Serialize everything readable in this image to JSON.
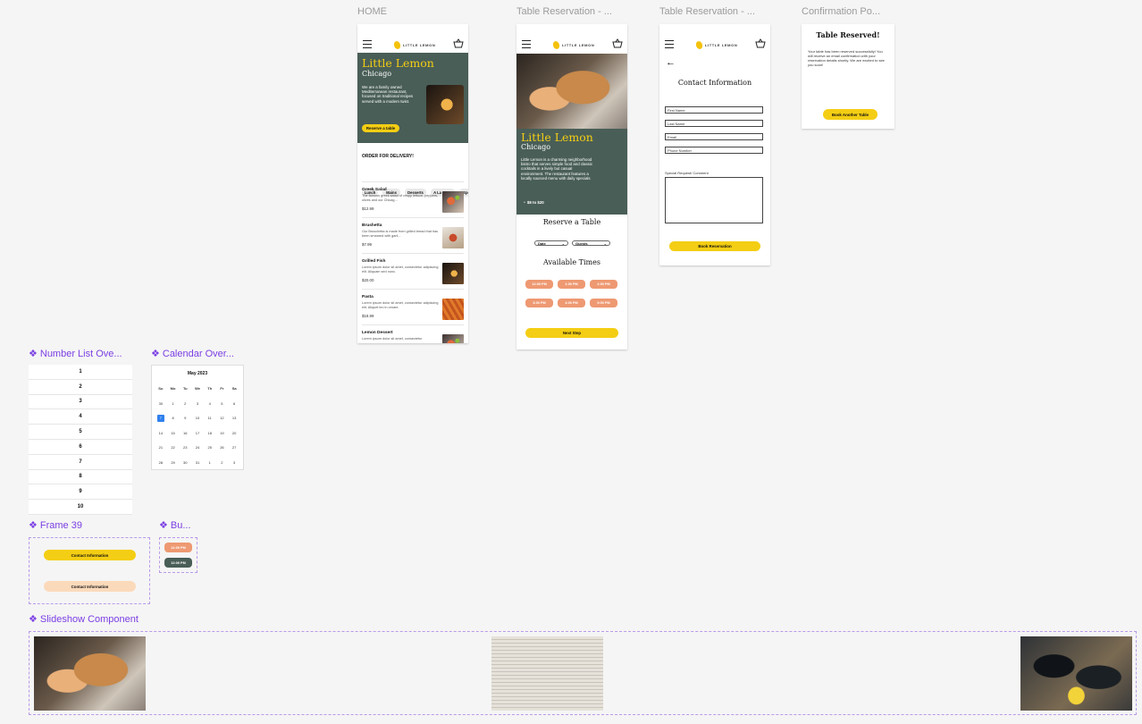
{
  "frames": {
    "home": "HOME",
    "reservation1": "Table Reservation - ...",
    "reservation2": "Table Reservation - ...",
    "confirmation": "Confirmation Po..."
  },
  "brand": {
    "logo_text": "LITTLE LEMON",
    "yellow": "#f4ce14",
    "green": "#495e57",
    "orange": "#ee9972",
    "peach": "#fbdabb",
    "purple": "#7b3fe4"
  },
  "home": {
    "title": "Little Lemon",
    "city": "Chicago",
    "description": "We are a family owned Mediterranean restaurant, focused on traditional recipes served with a modern twist.",
    "cta": "Reserve a table",
    "delivery_heading": "ORDER FOR DELIVERY!",
    "categories": [
      "Lunch",
      "Mains",
      "Desserts",
      "A La Carte",
      "Spe"
    ],
    "menu": [
      {
        "name": "Greek Salad",
        "desc": "The famous greek salad of crispy lettuce, peppers, olives and our Chicag...",
        "price": "$12.99"
      },
      {
        "name": "Brushetta",
        "desc": "Our Bruschetta is made from grilled bread that has been smeared with garli...",
        "price": "$7.99"
      },
      {
        "name": "Grilled Fish",
        "desc": "Lorem ipsum dolor sit amet, consectetur adipiscing elit. Aliquam sed nunc.",
        "price": "$20.00"
      },
      {
        "name": "Pasta",
        "desc": "Lorem ipsum dolor sit amet, consectetur adipiscing elit. Aliquet leo in ornare.",
        "price": "$18.99"
      },
      {
        "name": "Lemon Dessert",
        "desc": "Lorem ipsum dolor sit amet, consectetur",
        "price": ""
      }
    ]
  },
  "reservation": {
    "title": "Little Lemon",
    "city": "Chicago",
    "description": "Little Lemon is a charming neighborhood bistro that serves simple food and classic cocktails in a lively but casual environment. The restaurant features a locally sourced menu with daily specials",
    "price_range": "$8 to $20",
    "reserve_heading": "Reserve a Table",
    "date_label": "Date",
    "guests_label": "Guests",
    "times_heading": "Available Times",
    "times": [
      "12:00 PM",
      "1:00 PM",
      "2:00 PM",
      "3:00 PM",
      "4:00 PM",
      "5:00 PM"
    ],
    "next": "Next Step"
  },
  "contact": {
    "heading": "Contact Information",
    "fields": [
      "First Name",
      "Last Name",
      "Email",
      "Phone Number"
    ],
    "special_label": "Special Request/ Comment",
    "submit": "Book Reservation"
  },
  "confirmation": {
    "heading": "Table Reserved!",
    "body": "Your table has been reserved successfully! You will receive an email confirmation with your reservation details shortly. We are excited to see you soon!",
    "button": "Book Another Table"
  },
  "components": {
    "number_list": "Number List Ove...",
    "calendar": "Calendar Over...",
    "frame39": "Frame 39",
    "button": "Bu...",
    "slideshow": "Slideshow Component"
  },
  "number_list": [
    "1",
    "2",
    "3",
    "4",
    "5",
    "6",
    "7",
    "8",
    "9",
    "10"
  ],
  "calendar": {
    "month": "May 2023",
    "weekdays": [
      "Su",
      "Mo",
      "Tu",
      "We",
      "Th",
      "Fr",
      "Sa"
    ],
    "days": [
      "30",
      "1",
      "2",
      "3",
      "4",
      "5",
      "6",
      "7",
      "8",
      "9",
      "10",
      "11",
      "12",
      "13",
      "14",
      "15",
      "16",
      "17",
      "18",
      "19",
      "20",
      "21",
      "22",
      "23",
      "24",
      "25",
      "26",
      "27",
      "28",
      "29",
      "30",
      "31",
      "1",
      "2",
      "3"
    ],
    "selected": "7"
  },
  "frame39": {
    "btn1": "Contact Information",
    "btn2": "Contact Information"
  },
  "button_variants": {
    "a": "12:00 PM",
    "b": "12:00 PM"
  }
}
